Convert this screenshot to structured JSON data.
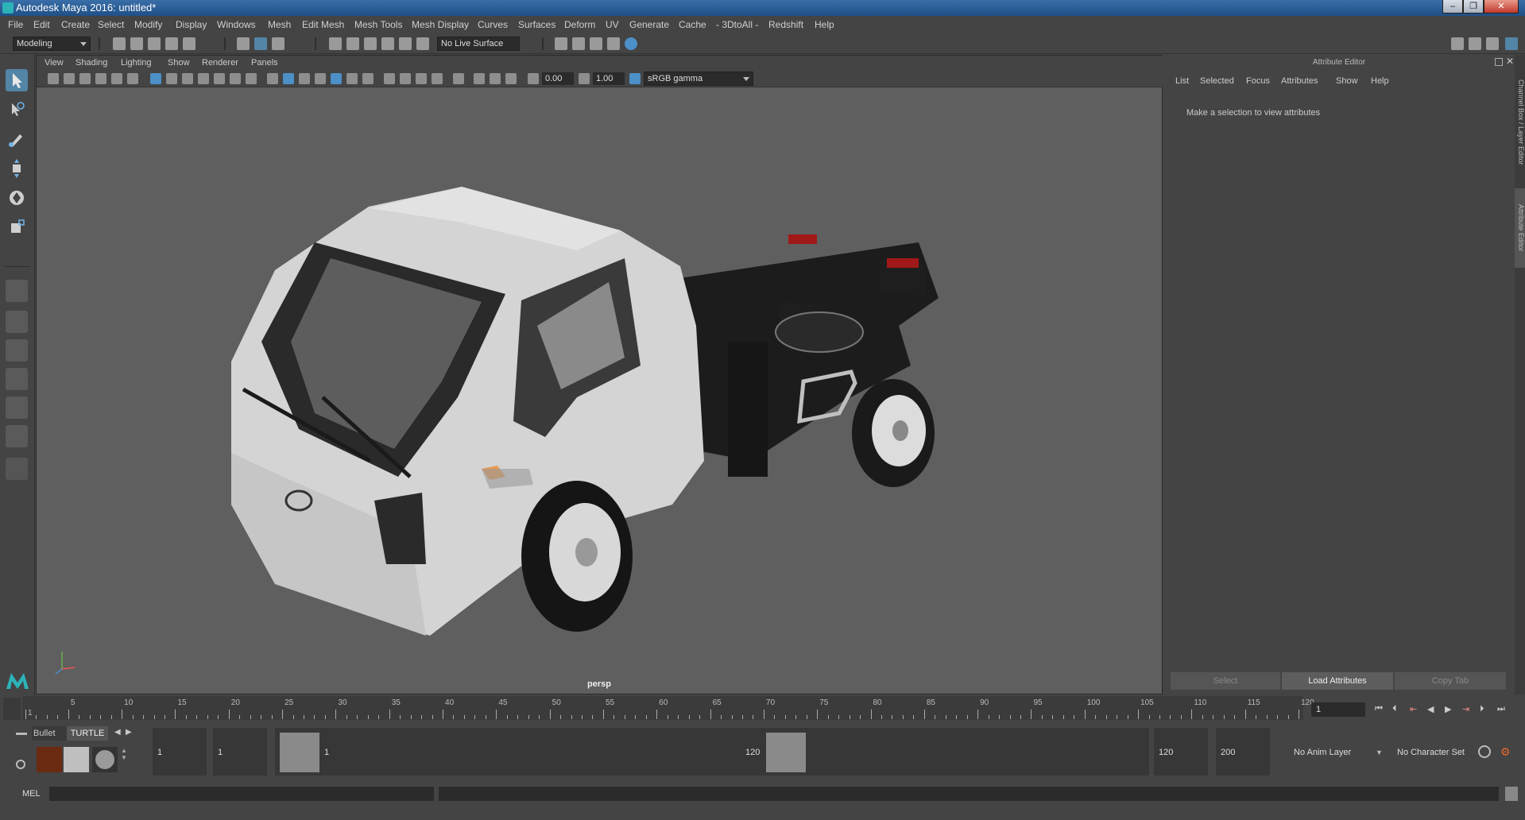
{
  "window": {
    "title": "Autodesk Maya 2016: untitled*"
  },
  "menubar": [
    "File",
    "Edit",
    "Create",
    "Select",
    "Modify",
    "Display",
    "Windows",
    "Mesh",
    "Edit Mesh",
    "Mesh Tools",
    "Mesh Display",
    "Curves",
    "Surfaces",
    "Deform",
    "UV",
    "Generate",
    "Cache",
    "- 3DtoAll -",
    "Redshift",
    "Help"
  ],
  "toolbar": {
    "mode": "Modeling",
    "live_surface": "No Live Surface"
  },
  "viewport": {
    "menus": [
      "View",
      "Shading",
      "Lighting",
      "Show",
      "Renderer",
      "Panels"
    ],
    "exposure": "0.00",
    "gamma": "1.00",
    "color_space": "sRGB gamma",
    "camera_label": "persp"
  },
  "attribute_editor": {
    "title": "Attribute Editor",
    "tabs": [
      "List",
      "Selected",
      "Focus",
      "Attributes",
      "Show",
      "Help"
    ],
    "message": "Make a selection to view attributes",
    "buttons": {
      "select": "Select",
      "load": "Load Attributes",
      "copy": "Copy Tab"
    }
  },
  "side_tabs": {
    "channel_box": "Channel Box / Layer Editor",
    "attr": "Attribute Editor"
  },
  "timeline": {
    "ticks": [
      "1",
      "5",
      "10",
      "15",
      "20",
      "25",
      "30",
      "35",
      "40",
      "45",
      "50",
      "55",
      "60",
      "65",
      "70",
      "75",
      "80",
      "85",
      "90",
      "95",
      "100",
      "105",
      "110",
      "115",
      "120"
    ],
    "current_frame": "1"
  },
  "shelf": {
    "tab_bullet": "Bullet",
    "tab_turtle": "TURTLE"
  },
  "range": {
    "start": "1",
    "playback_start": "1",
    "range_min_label": "1",
    "range_max_label": "120",
    "playback_end": "120",
    "end": "200",
    "anim_layer": "No Anim Layer",
    "character_set": "No Character Set"
  },
  "command_line": {
    "label": "MEL"
  }
}
